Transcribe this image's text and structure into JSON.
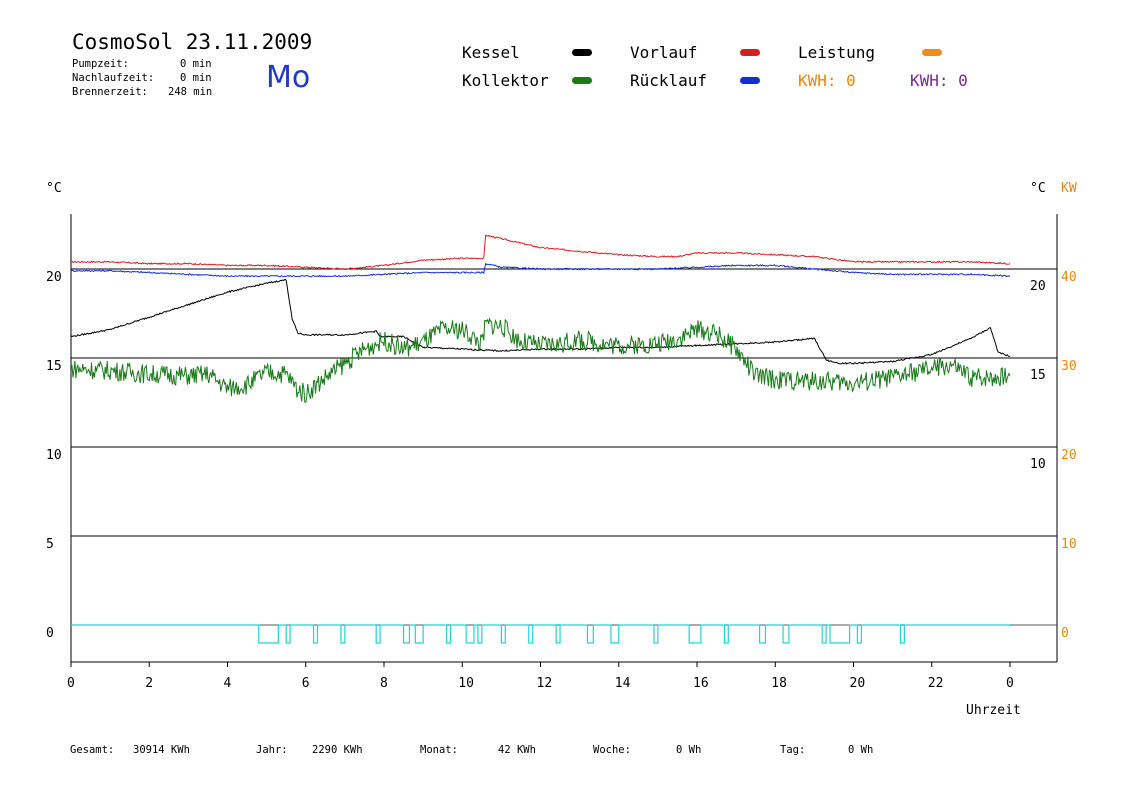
{
  "header": {
    "title": "CosmoSol 23.11.2009",
    "weekday": "Mo",
    "stats": [
      {
        "label": "Pumpzeit:",
        "value": "0 min"
      },
      {
        "label": "Nachlaufzeit:",
        "value": "0 min"
      },
      {
        "label": "Brennerzeit:",
        "value": "248 min"
      }
    ]
  },
  "legend": {
    "kessel": "Kessel",
    "vorlauf": "Vorlauf",
    "leistung": "Leistung",
    "kollektor": "Kollektor",
    "ruecklauf": "Rücklauf",
    "kwh1": "KWH: 0",
    "kwh2": "KWH: 0"
  },
  "colors": {
    "kessel": "#000000",
    "vorlauf": "#d81e1e",
    "leistung": "#f08a1c",
    "kollektor": "#1a7a1a",
    "ruecklauf": "#1230d0",
    "pump": "#22d3d3",
    "kw_axis": "#e8870f",
    "kwh2": "#7a2a8e"
  },
  "footer": [
    {
      "label": "Gesamt:",
      "value": "30914 KWh"
    },
    {
      "label": "Jahr:",
      "value": "2290 KWh"
    },
    {
      "label": "Monat:",
      "value": "42 KWh"
    },
    {
      "label": "Woche:",
      "value": "0 Wh"
    },
    {
      "label": "Tag:",
      "value": "0 Wh"
    }
  ],
  "chart_data": {
    "type": "line",
    "xlabel": "Uhrzeit",
    "x_ticks": [
      "0",
      "2",
      "4",
      "6",
      "8",
      "10",
      "12",
      "14",
      "16",
      "18",
      "20",
      "22",
      "0"
    ],
    "x_range": [
      0,
      24
    ],
    "left_axis": {
      "unit": "°C",
      "ticks": [
        0,
        5,
        10,
        15,
        20
      ],
      "range": [
        -2,
        25
      ]
    },
    "right_axis_temp": {
      "unit": "°C",
      "ticks": [
        10,
        15,
        20
      ]
    },
    "right_axis_kw": {
      "unit": "KW",
      "ticks": [
        0,
        10,
        20,
        30,
        40
      ]
    },
    "grid_lines_y": [
      0,
      5,
      10,
      15,
      20
    ],
    "series": [
      {
        "name": "Vorlauf",
        "color_key": "vorlauf",
        "points": [
          [
            0,
            20.4
          ],
          [
            1,
            20.4
          ],
          [
            2,
            20.3
          ],
          [
            3,
            20.3
          ],
          [
            4,
            20.2
          ],
          [
            5,
            20.2
          ],
          [
            6,
            20.1
          ],
          [
            7,
            20.0
          ],
          [
            8,
            20.2
          ],
          [
            9,
            20.5
          ],
          [
            10,
            20.6
          ],
          [
            10.55,
            20.6
          ],
          [
            10.6,
            21.9
          ],
          [
            11,
            21.7
          ],
          [
            12,
            21.2
          ],
          [
            13,
            21.0
          ],
          [
            14,
            20.8
          ],
          [
            15,
            20.7
          ],
          [
            15.5,
            20.7
          ],
          [
            16,
            20.9
          ],
          [
            17,
            20.9
          ],
          [
            18,
            20.8
          ],
          [
            19,
            20.7
          ],
          [
            20,
            20.4
          ],
          [
            21,
            20.4
          ],
          [
            22,
            20.4
          ],
          [
            23,
            20.4
          ],
          [
            24,
            20.3
          ]
        ]
      },
      {
        "name": "Rücklauf",
        "color_key": "ruecklauf",
        "points": [
          [
            0,
            19.9
          ],
          [
            1,
            19.9
          ],
          [
            2,
            19.8
          ],
          [
            3,
            19.7
          ],
          [
            4,
            19.6
          ],
          [
            5,
            19.6
          ],
          [
            6,
            19.6
          ],
          [
            7,
            19.6
          ],
          [
            8,
            19.7
          ],
          [
            9,
            19.8
          ],
          [
            10,
            19.8
          ],
          [
            10.55,
            19.8
          ],
          [
            10.6,
            20.3
          ],
          [
            11,
            20.1
          ],
          [
            12,
            20.0
          ],
          [
            13,
            20.0
          ],
          [
            14,
            20.0
          ],
          [
            15,
            20.0
          ],
          [
            16,
            20.1
          ],
          [
            17,
            20.2
          ],
          [
            18,
            20.2
          ],
          [
            19,
            20.0
          ],
          [
            20,
            19.8
          ],
          [
            21,
            19.7
          ],
          [
            22,
            19.7
          ],
          [
            23,
            19.7
          ],
          [
            24,
            19.6
          ]
        ]
      },
      {
        "name": "Kessel",
        "color_key": "kessel",
        "points": [
          [
            0,
            16.2
          ],
          [
            1,
            16.6
          ],
          [
            2,
            17.3
          ],
          [
            3,
            18.0
          ],
          [
            4,
            18.7
          ],
          [
            5,
            19.2
          ],
          [
            5.5,
            19.4
          ],
          [
            5.65,
            17.2
          ],
          [
            5.8,
            16.4
          ],
          [
            6,
            16.3
          ],
          [
            7,
            16.3
          ],
          [
            7.8,
            16.5
          ],
          [
            7.9,
            16.2
          ],
          [
            8.5,
            16.2
          ],
          [
            9,
            15.6
          ],
          [
            10,
            15.5
          ],
          [
            11,
            15.4
          ],
          [
            12,
            15.5
          ],
          [
            13,
            15.5
          ],
          [
            14,
            15.6
          ],
          [
            15,
            15.6
          ],
          [
            16,
            15.7
          ],
          [
            17,
            15.8
          ],
          [
            18,
            15.9
          ],
          [
            19,
            16.1
          ],
          [
            19.3,
            14.9
          ],
          [
            19.6,
            14.7
          ],
          [
            20,
            14.7
          ],
          [
            21,
            14.8
          ],
          [
            22,
            15.2
          ],
          [
            23,
            16.1
          ],
          [
            23.5,
            16.7
          ],
          [
            23.7,
            15.3
          ],
          [
            24,
            15.1
          ]
        ]
      },
      {
        "name": "Kollektor",
        "color_key": "kollektor",
        "points": [
          [
            0,
            14.4
          ],
          [
            1,
            14.3
          ],
          [
            2,
            14.1
          ],
          [
            3,
            14.0
          ],
          [
            3.5,
            14.1
          ],
          [
            4,
            13.3
          ],
          [
            4.5,
            13.5
          ],
          [
            5,
            14.2
          ],
          [
            5.5,
            14.1
          ],
          [
            5.8,
            13.2
          ],
          [
            6,
            13.0
          ],
          [
            6.5,
            13.9
          ],
          [
            7,
            14.7
          ],
          [
            7.5,
            15.5
          ],
          [
            8,
            16.0
          ],
          [
            8.5,
            15.5
          ],
          [
            9,
            15.9
          ],
          [
            9.5,
            16.6
          ],
          [
            10,
            16.6
          ],
          [
            10.5,
            15.8
          ],
          [
            10.6,
            16.9
          ],
          [
            11,
            16.8
          ],
          [
            11.5,
            15.9
          ],
          [
            12,
            15.7
          ],
          [
            12.5,
            15.8
          ],
          [
            13,
            16.0
          ],
          [
            14,
            15.7
          ],
          [
            15,
            15.8
          ],
          [
            15.5,
            16.1
          ],
          [
            16,
            16.6
          ],
          [
            16.5,
            16.4
          ],
          [
            17,
            15.5
          ],
          [
            17.5,
            14.0
          ],
          [
            18,
            13.8
          ],
          [
            19,
            13.7
          ],
          [
            20,
            13.6
          ],
          [
            21,
            13.9
          ],
          [
            22,
            14.4
          ],
          [
            22.5,
            14.6
          ],
          [
            23,
            13.9
          ],
          [
            24,
            14.0
          ]
        ]
      }
    ],
    "pump_pulses_hours": [
      [
        4.8,
        5.3
      ],
      [
        5.5,
        5.6
      ],
      [
        6.2,
        6.3
      ],
      [
        6.9,
        7.0
      ],
      [
        7.8,
        7.9
      ],
      [
        8.5,
        8.65
      ],
      [
        8.8,
        9.0
      ],
      [
        9.6,
        9.7
      ],
      [
        10.1,
        10.3
      ],
      [
        10.4,
        10.5
      ],
      [
        11.0,
        11.1
      ],
      [
        11.7,
        11.8
      ],
      [
        12.4,
        12.5
      ],
      [
        13.2,
        13.35
      ],
      [
        13.8,
        14.0
      ],
      [
        14.9,
        15.0
      ],
      [
        15.8,
        16.1
      ],
      [
        16.7,
        16.8
      ],
      [
        17.6,
        17.75
      ],
      [
        18.2,
        18.35
      ],
      [
        19.2,
        19.3
      ],
      [
        19.4,
        19.9
      ],
      [
        20.1,
        20.2
      ],
      [
        21.2,
        21.3
      ]
    ]
  }
}
